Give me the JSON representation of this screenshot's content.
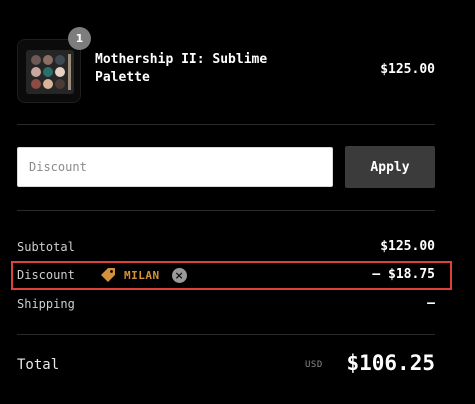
{
  "product": {
    "quantity": "1",
    "name": "Mothership II: Sublime Palette",
    "price": "$125.00",
    "thumbnail_icon": "eyeshadow-palette-icon"
  },
  "discount_form": {
    "placeholder": "Discount",
    "value": "",
    "apply_label": "Apply"
  },
  "summary": {
    "subtotal_label": "Subtotal",
    "subtotal_value": "$125.00",
    "discount_label": "Discount",
    "discount_code": "MILAN",
    "discount_tag_icon": "tag-icon",
    "discount_remove_icon": "close-circle-icon",
    "discount_value": "– $18.75",
    "shipping_label": "Shipping",
    "shipping_value": "—",
    "total_label": "Total",
    "total_currency": "USD",
    "total_value": "$106.25"
  },
  "colors": {
    "background": "#000000",
    "highlight_border": "#e0403c",
    "discount_code": "#d2913a",
    "button_bg": "#3b3b3b"
  }
}
